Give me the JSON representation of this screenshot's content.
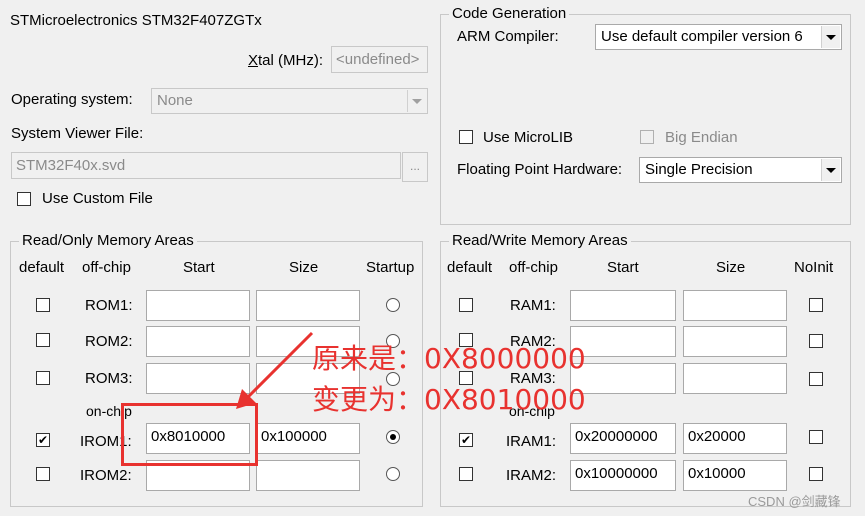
{
  "device_name": "STMicroelectronics STM32F407ZGTx",
  "xtal": {
    "label_prefix": "X",
    "label_rest": "tal (MHz):",
    "value": "<undefined>"
  },
  "os": {
    "label": "Operating system:",
    "value": "None"
  },
  "svd": {
    "label": "System Viewer File:",
    "value": "STM32F40x.svd",
    "browse": "...",
    "custom_label": "Use Custom File"
  },
  "codegen": {
    "title": "Code Generation",
    "compiler_label": "ARM Compiler:",
    "compiler_value": "Use default compiler version 6",
    "microlib_label": "Use MicroLIB",
    "bigendian_label": "Big Endian",
    "fph_label": "Floating Point Hardware:",
    "fph_value": "Single Precision"
  },
  "ro": {
    "title": "Read/Only Memory Areas",
    "headers": {
      "default": "default",
      "offchip": "off-chip",
      "start": "Start",
      "size": "Size",
      "extra": "Startup"
    },
    "onchip_label": "on-chip",
    "rows": [
      {
        "name": "ROM1:",
        "start": "",
        "size": "",
        "default": false,
        "startup": false
      },
      {
        "name": "ROM2:",
        "start": "",
        "size": "",
        "default": false,
        "startup": false
      },
      {
        "name": "ROM3:",
        "start": "",
        "size": "",
        "default": false,
        "startup": false
      },
      {
        "name": "IROM1:",
        "start": "0x8010000",
        "size": "0x100000",
        "default": true,
        "startup": true
      },
      {
        "name": "IROM2:",
        "start": "",
        "size": "",
        "default": false,
        "startup": false
      }
    ]
  },
  "rw": {
    "title": "Read/Write Memory Areas",
    "headers": {
      "default": "default",
      "offchip": "off-chip",
      "start": "Start",
      "size": "Size",
      "extra": "NoInit"
    },
    "onchip_label": "on-chip",
    "rows": [
      {
        "name": "RAM1:",
        "start": "",
        "size": "",
        "default": false,
        "noinit": false
      },
      {
        "name": "RAM2:",
        "start": "",
        "size": "",
        "default": false,
        "noinit": false
      },
      {
        "name": "RAM3:",
        "start": "",
        "size": "",
        "default": false,
        "noinit": false
      },
      {
        "name": "IRAM1:",
        "start": "0x20000000",
        "size": "0x20000",
        "default": true,
        "noinit": false
      },
      {
        "name": "IRAM2:",
        "start": "0x10000000",
        "size": "0x10000",
        "default": false,
        "noinit": false
      }
    ]
  },
  "annotation": {
    "line1": "原来是：0X8000000",
    "line2": "变更为：0X8010000",
    "color": "#e8322f"
  },
  "watermark": "CSDN @剑藏锋"
}
